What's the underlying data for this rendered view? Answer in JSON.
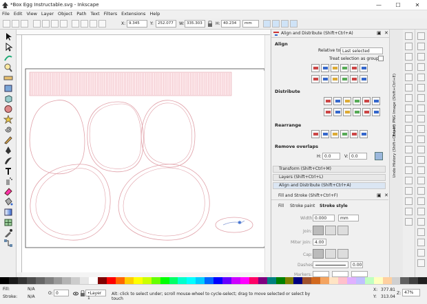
{
  "window": {
    "title": "*Box Egg Instructable.svg - Inkscape",
    "minimize": "—",
    "maximize": "☐",
    "close": "✕"
  },
  "menu": [
    "File",
    "Edit",
    "View",
    "Layer",
    "Object",
    "Path",
    "Text",
    "Filters",
    "Extensions",
    "Help"
  ],
  "toolctrl": {
    "x_label": "X:",
    "x_value": "9.345",
    "y_label": "Y:",
    "y_value": "252.077",
    "w_label": "W:",
    "w_value": "335.303",
    "h_label": "H:",
    "h_value": "40.234",
    "unit": "mm"
  },
  "dock_tab_labels": [
    "Export PNG Image (Shift+Ctrl+E)",
    "Undo History (Shift+Ctrl+H)"
  ],
  "align": {
    "title": "Align and Distribute (Shift+Ctrl+A)",
    "section_align": "Align",
    "relative_label": "Relative to:",
    "relative_value": "Last selected",
    "group_label": "Treat selection as group:",
    "section_distribute": "Distribute",
    "section_rearrange": "Rearrange",
    "section_overlaps": "Remove overlaps",
    "h_label": "H:",
    "h_value": "0.0",
    "v_label": "V:",
    "v_value": "0.0"
  },
  "collapsed": [
    {
      "label": "Transform (Shift+Ctrl+M)"
    },
    {
      "label": "Layers (Shift+Ctrl+L)"
    },
    {
      "label": "Align and Distribute (Shift+Ctrl+A)"
    }
  ],
  "fill": {
    "title": "Fill and Stroke (Shift+Ctrl+F)",
    "tab_fill": "Fill",
    "tab_paint": "Stroke paint",
    "tab_style": "Stroke style",
    "width_label": "Width:",
    "width_value": "0.000",
    "width_unit": "mm",
    "join_label": "Join:",
    "miter_label": "Miter join:",
    "miter_value": "4.00",
    "cap_label": "Cap:",
    "dashes_label": "Dashes:",
    "dashes_value": "0.00",
    "markers_label": "Markers:"
  },
  "status": {
    "fill_label": "Fill:",
    "fill_value": "N/A",
    "stroke_label": "Stroke:",
    "stroke_value": "N/A",
    "opacity_label": "O:",
    "opacity_value": "0",
    "layer": "•Layer 1",
    "message": "Alt: click to select under; scroll mouse-wheel to cycle-select; drag to move selected or select by touch",
    "x_label": "X:",
    "x_value": "377.81",
    "y_label": "Y:",
    "y_value": "313.04",
    "z_label": "Z:",
    "zoom": "47%"
  },
  "palette_colors": [
    "#000000",
    "#1a1a1a",
    "#333333",
    "#4d4d4d",
    "#666666",
    "#808080",
    "#999999",
    "#b3b3b3",
    "#cccccc",
    "#e6e6e6",
    "#ffffff",
    "#800000",
    "#ff0000",
    "#ff6600",
    "#ffcc00",
    "#ffff00",
    "#ccff00",
    "#66ff00",
    "#00ff00",
    "#00ff66",
    "#00ffcc",
    "#00ffff",
    "#00ccff",
    "#0066ff",
    "#0000ff",
    "#6600ff",
    "#cc00ff",
    "#ff00ff",
    "#ff0066",
    "#800080",
    "#008080",
    "#008000",
    "#808000",
    "#000080",
    "#a0522d",
    "#d2691e",
    "#f4a460",
    "#ffe4c4",
    "#ffc0cb",
    "#e0b0ff",
    "#c0c0ff",
    "#c0ffc0",
    "#ffffc0",
    "#ffd0a0",
    "#d0d0d0",
    "#606060",
    "#404040",
    "#202020"
  ],
  "colors": {
    "accent": "#3b82c4",
    "shape_stroke": "#e0a0a8"
  }
}
